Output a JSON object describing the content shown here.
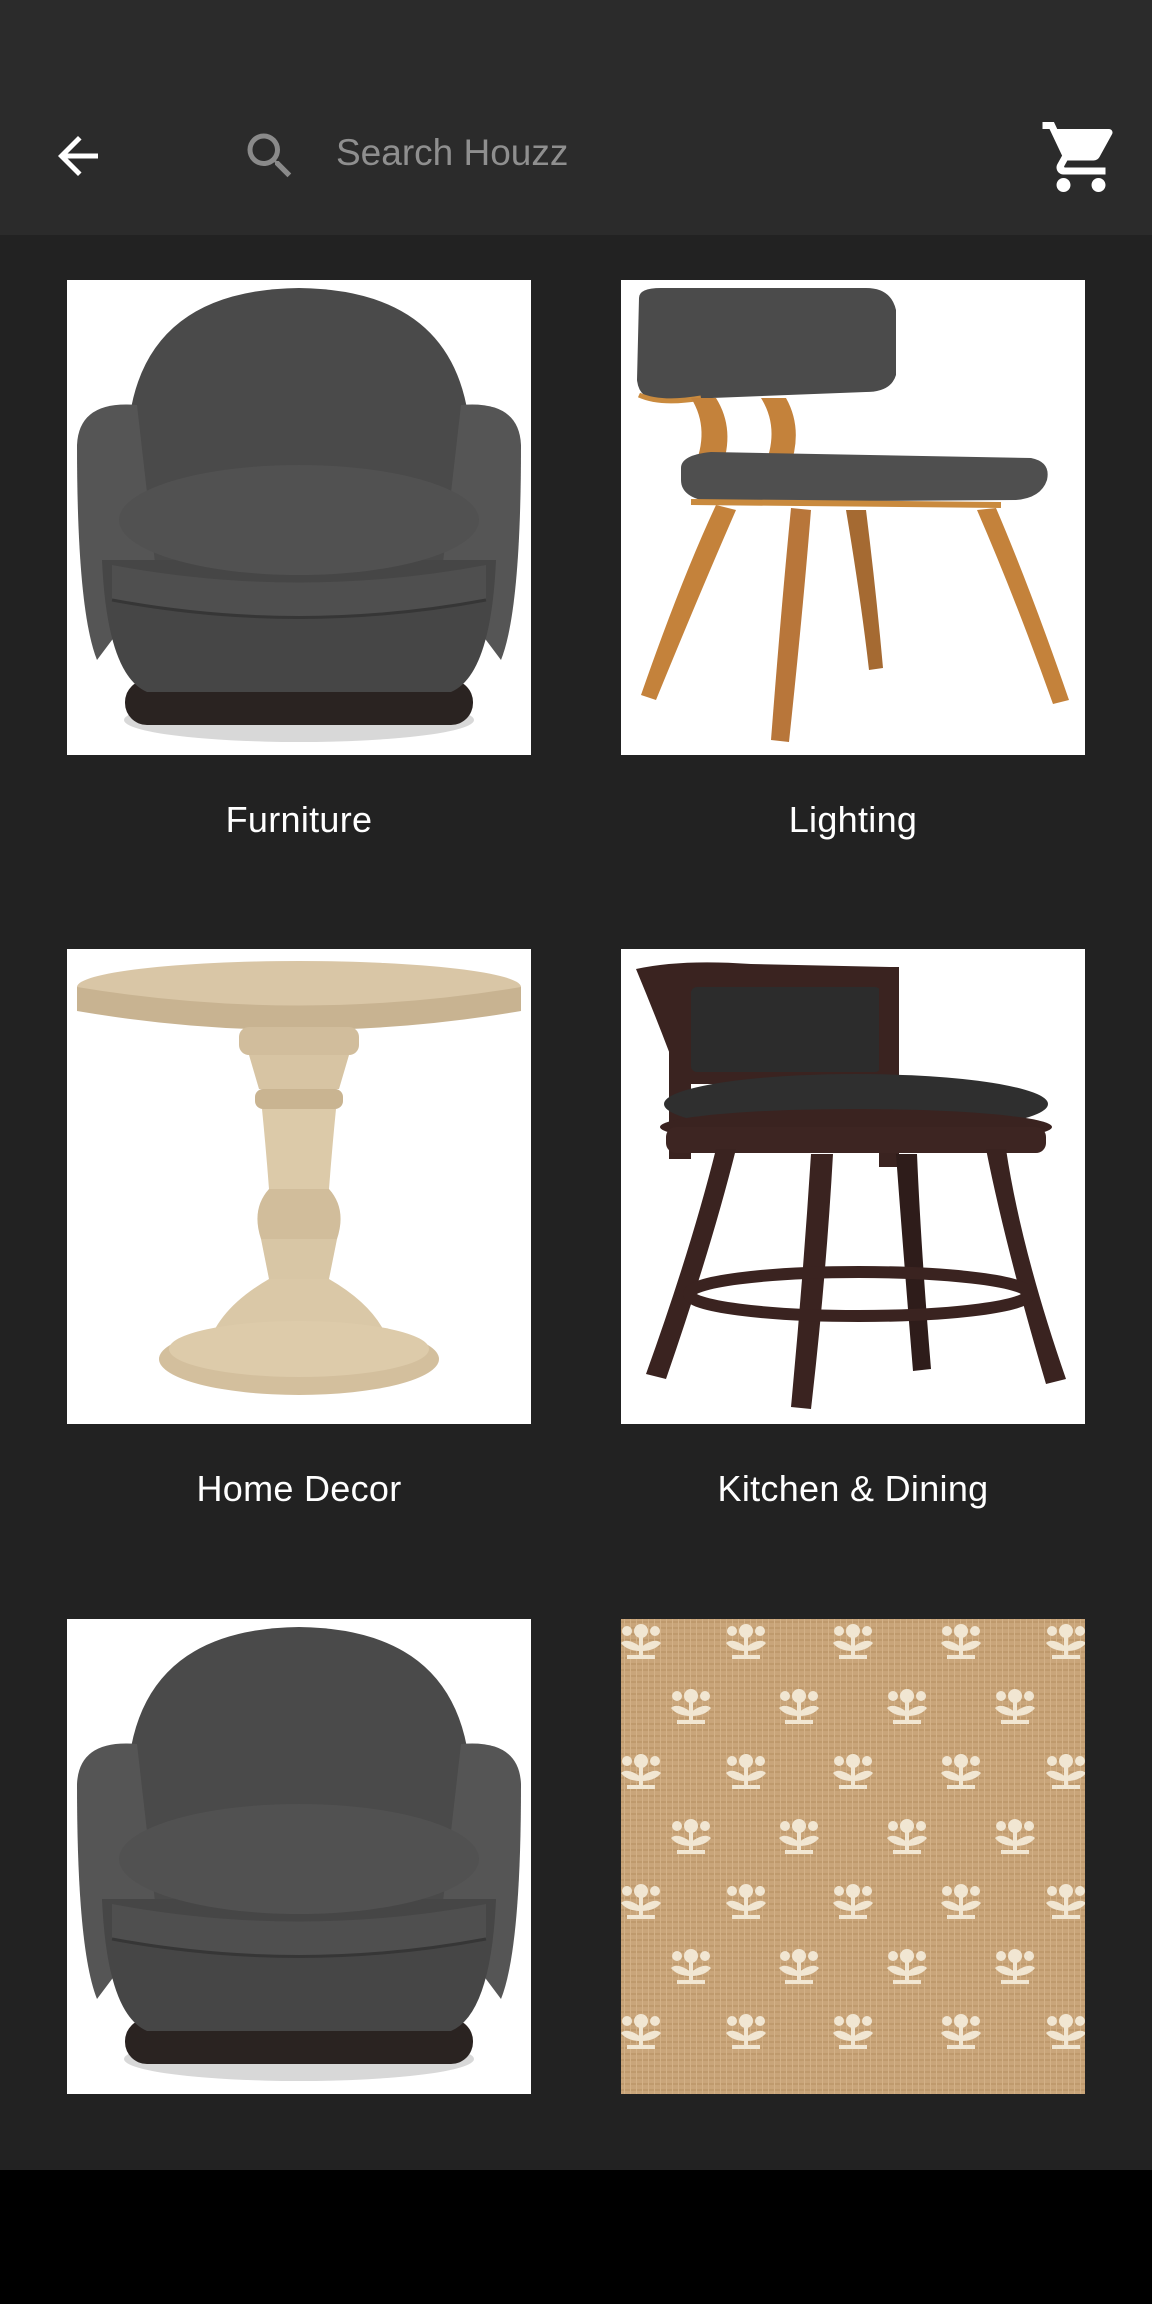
{
  "header": {
    "back_icon": "arrow-left-icon",
    "search": {
      "placeholder": "Search Houzz",
      "value": "",
      "icon": "search-icon"
    },
    "cart_icon": "shopping-cart-icon"
  },
  "categories": [
    {
      "label": "Furniture",
      "image": "gray-swivel-armchair"
    },
    {
      "label": "Lighting",
      "image": "bentwood-dining-chair"
    },
    {
      "label": "Home Decor",
      "image": "pedestal-accent-table"
    },
    {
      "label": "Kitchen & Dining",
      "image": "swivel-counter-stool"
    },
    {
      "label": "",
      "image": "gray-swivel-armchair"
    },
    {
      "label": "",
      "image": "jute-floral-rug"
    }
  ],
  "colors": {
    "app_bar": "#2b2b2b",
    "background": "#222222",
    "text": "#ffffff",
    "placeholder": "#8f8f8f"
  }
}
